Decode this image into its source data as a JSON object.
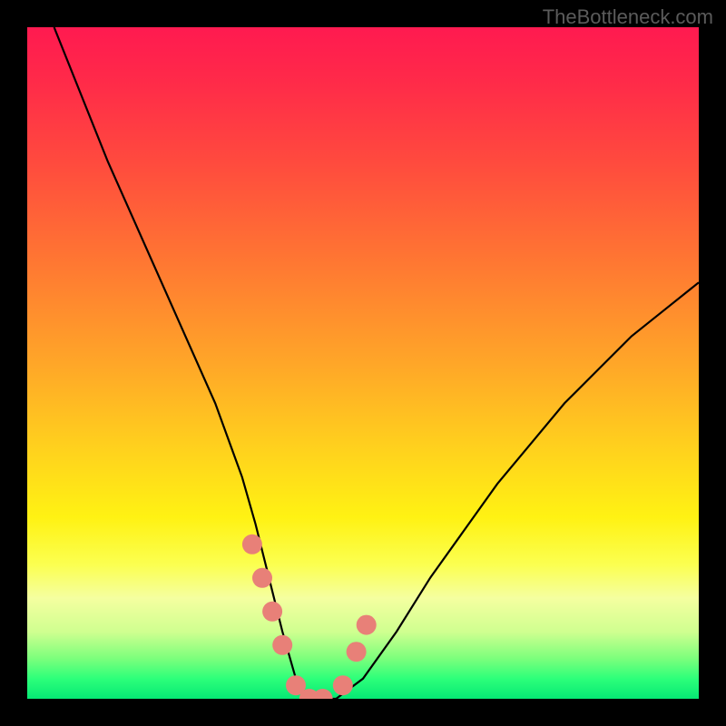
{
  "watermark": "TheBottleneck.com",
  "chart_data": {
    "type": "line",
    "title": "",
    "xlabel": "",
    "ylabel": "",
    "xlim": [
      0,
      100
    ],
    "ylim": [
      0,
      100
    ],
    "series": [
      {
        "name": "bottleneck-curve",
        "x": [
          4,
          8,
          12,
          16,
          20,
          24,
          28,
          32,
          34,
          36,
          38,
          40,
          42,
          44,
          46,
          50,
          55,
          60,
          65,
          70,
          75,
          80,
          85,
          90,
          95,
          100
        ],
        "y": [
          100,
          90,
          80,
          71,
          62,
          53,
          44,
          33,
          26,
          18,
          10,
          3,
          0,
          0,
          0,
          3,
          10,
          18,
          25,
          32,
          38,
          44,
          49,
          54,
          58,
          62
        ]
      }
    ],
    "markers": {
      "name": "highlighted-points",
      "color": "#e88078",
      "x": [
        33.5,
        35,
        36.5,
        38,
        40,
        42,
        44,
        47,
        49,
        50.5
      ],
      "y": [
        23,
        18,
        13,
        8,
        2,
        0,
        0,
        2,
        7,
        11
      ]
    },
    "gradient_stops": [
      {
        "pos": 0,
        "color": "#ff1a50"
      },
      {
        "pos": 50,
        "color": "#ffa628"
      },
      {
        "pos": 75,
        "color": "#fff213"
      },
      {
        "pos": 100,
        "color": "#06e874"
      }
    ]
  }
}
